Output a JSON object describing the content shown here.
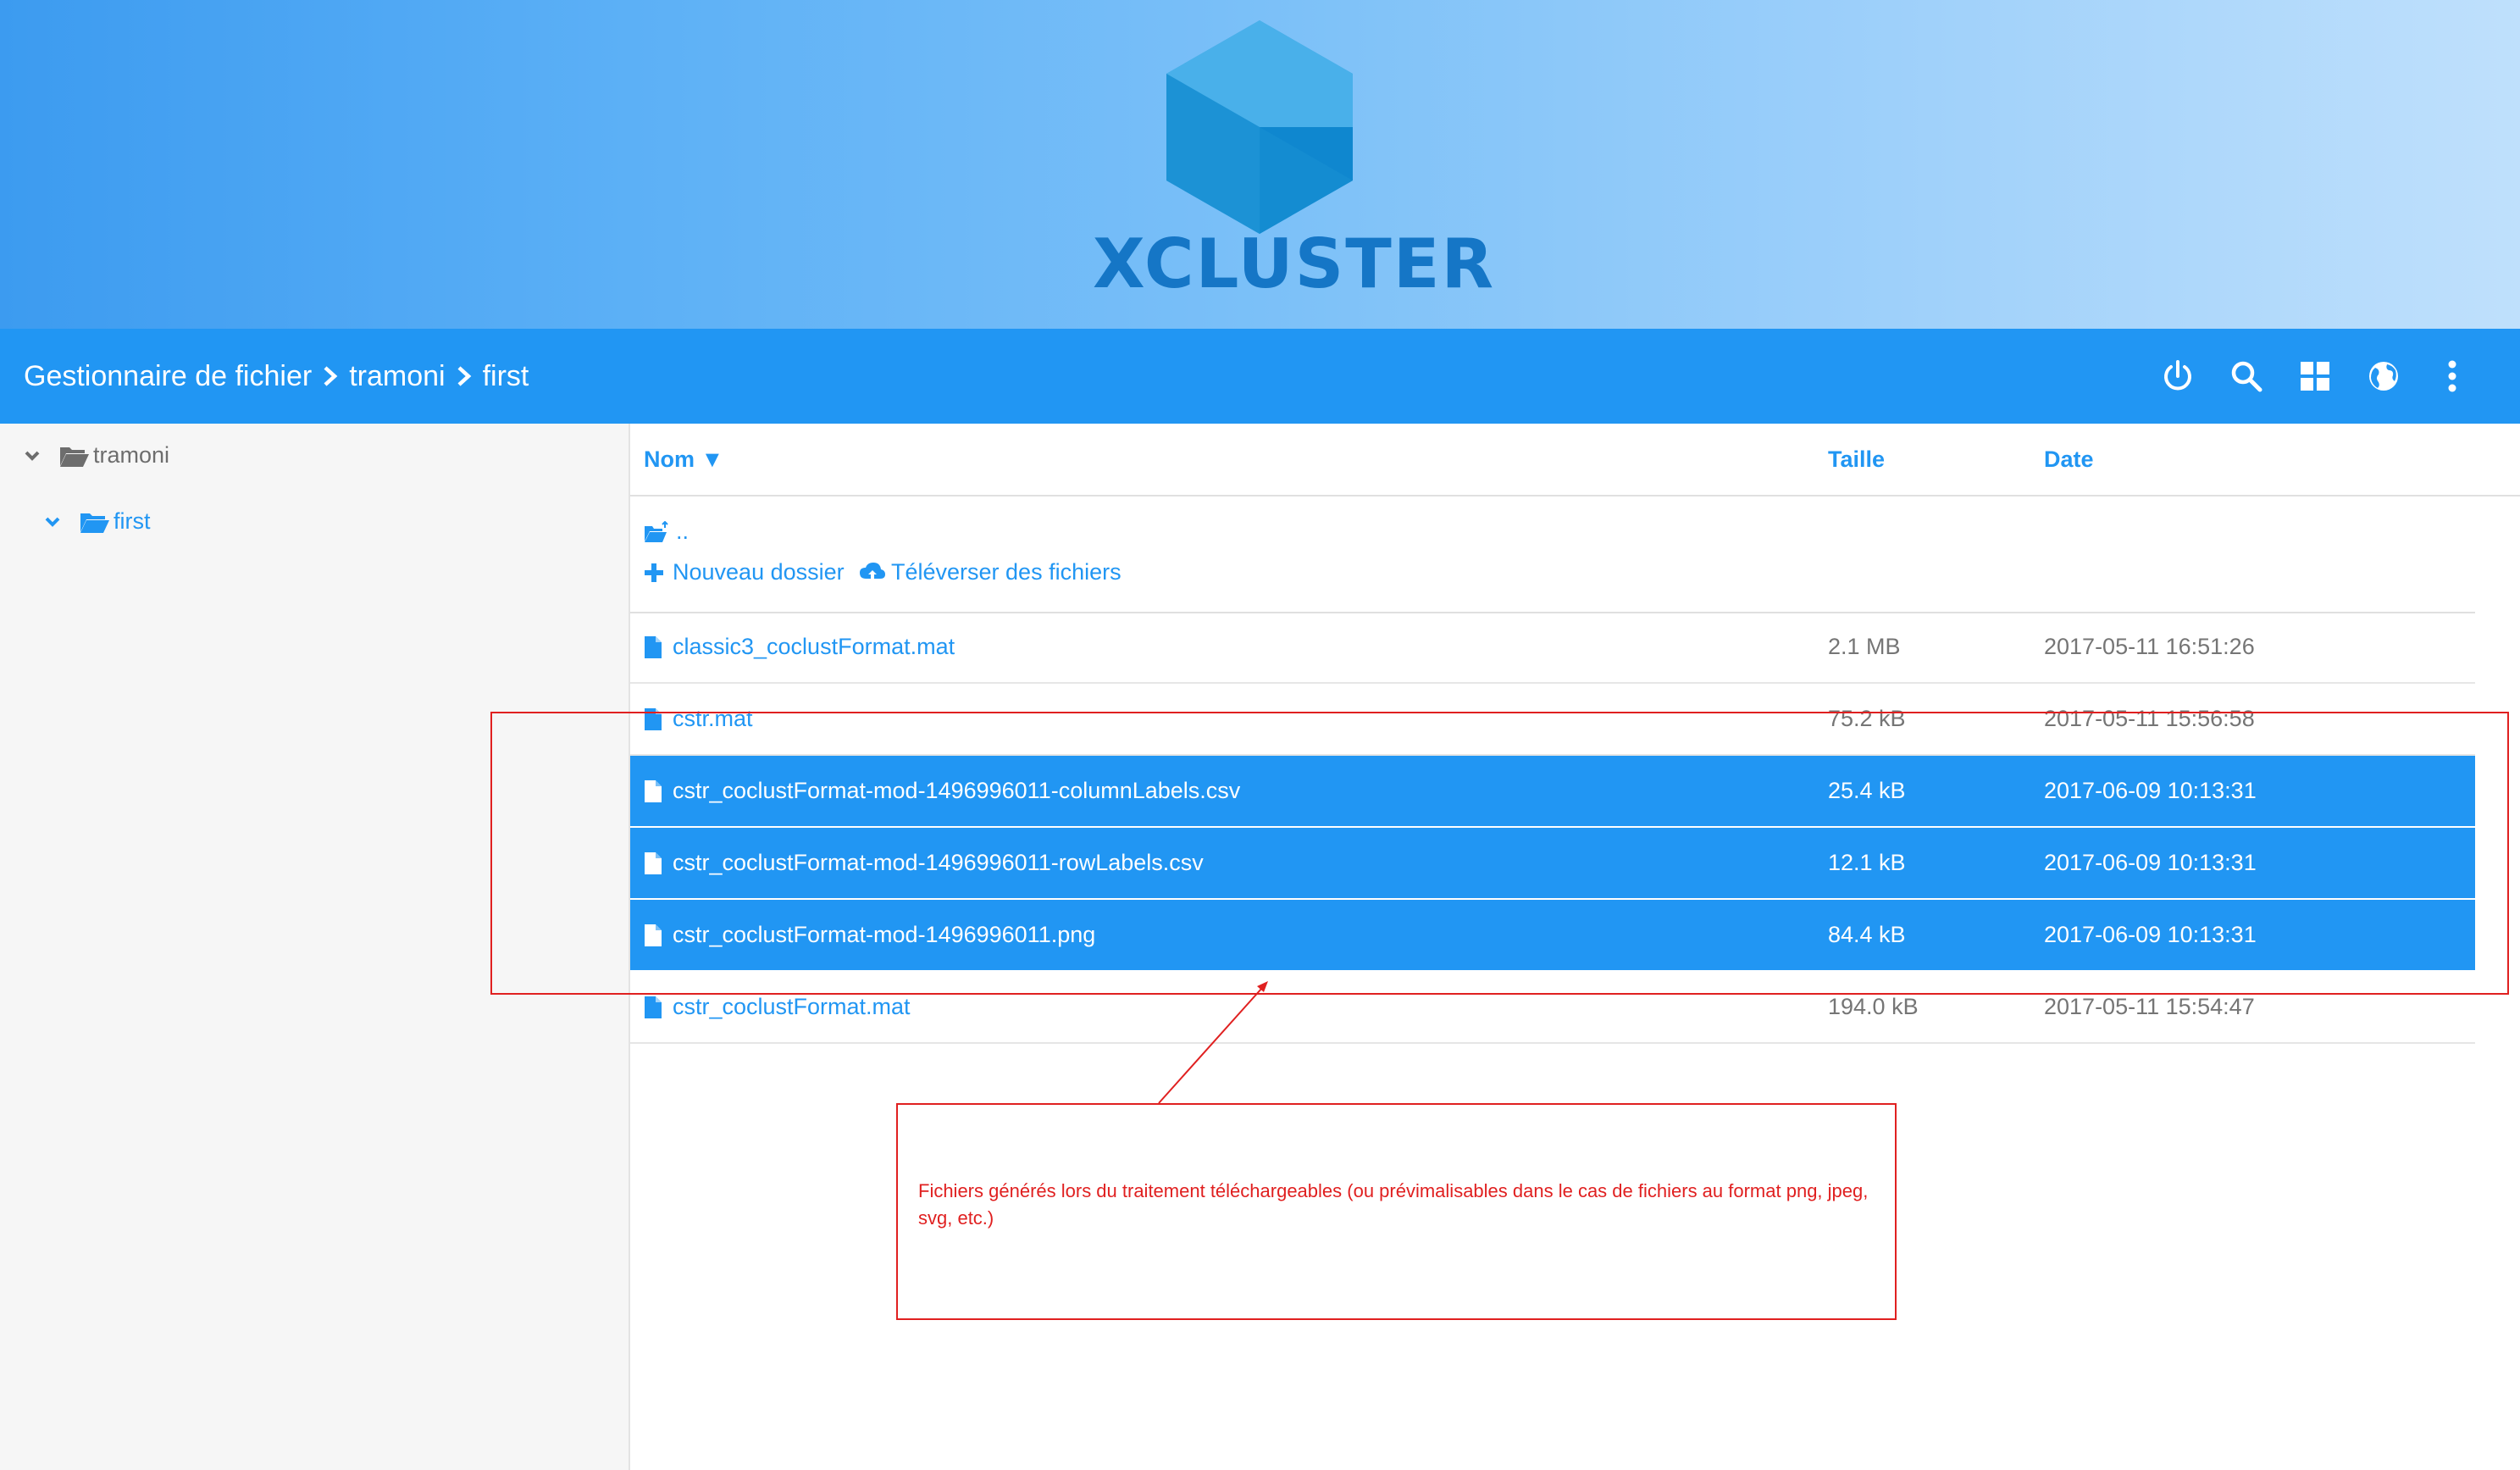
{
  "banner": {
    "logo_text": "XCLUSTER",
    "colors": {
      "hex_light": "#41a8e6",
      "hex_mid": "#1f97d8",
      "hex_dark": "#0e88cf",
      "text": "#1576c6"
    }
  },
  "toolbar": {
    "breadcrumbs": [
      "Gestionnaire de fichier",
      "tramoni",
      "first"
    ],
    "icons": [
      "power-icon",
      "search-icon",
      "grid-view-icon",
      "language-globe-icon",
      "more-vert-icon"
    ],
    "color": "#2196f3"
  },
  "sidebar": {
    "tree": [
      {
        "label": "tramoni",
        "expanded": true,
        "active": false
      },
      {
        "label": "first",
        "expanded": true,
        "active": true
      }
    ]
  },
  "list": {
    "columns": {
      "name": "Nom ▼",
      "size": "Taille",
      "date": "Date"
    },
    "parent_link": "..",
    "new_folder": "Nouveau dossier",
    "upload": "Téléverser des fichiers",
    "files": [
      {
        "name": "classic3_coclustFormat.mat",
        "size": "2.1 MB",
        "date": "2017-05-11 16:51:26",
        "selected": false
      },
      {
        "name": "cstr.mat",
        "size": "75.2 kB",
        "date": "2017-05-11 15:56:58",
        "selected": false
      },
      {
        "name": "cstr_coclustFormat-mod-1496996011-columnLabels.csv",
        "size": "25.4 kB",
        "date": "2017-06-09 10:13:31",
        "selected": true
      },
      {
        "name": "cstr_coclustFormat-mod-1496996011-rowLabels.csv",
        "size": "12.1 kB",
        "date": "2017-06-09 10:13:31",
        "selected": true
      },
      {
        "name": "cstr_coclustFormat-mod-1496996011.png",
        "size": "84.4 kB",
        "date": "2017-06-09 10:13:31",
        "selected": true
      },
      {
        "name": "cstr_coclustFormat.mat",
        "size": "194.0 kB",
        "date": "2017-05-11 15:54:47",
        "selected": false
      }
    ]
  },
  "annotation": {
    "note": "Fichiers générés lors du traitement téléchargeables (ou prévimalisables dans le cas de fichiers au format png, jpeg, svg, etc.)",
    "color": "#e02020"
  }
}
